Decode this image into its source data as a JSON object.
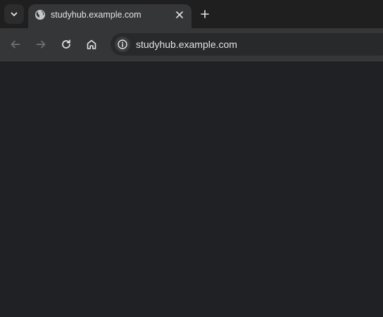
{
  "tab": {
    "title": "studyhub.example.com",
    "favicon": "globe-icon"
  },
  "toolbar": {
    "url": "studyhub.example.com",
    "icons": [
      "back-arrow-icon",
      "forward-arrow-icon",
      "reload-icon",
      "home-icon",
      "site-info-icon"
    ]
  },
  "colors": {
    "tabstrip": "#1f1f1f",
    "active_tab": "#353638",
    "toolbar": "#353638",
    "omnibox": "#28292b",
    "page": "#202124",
    "text": "#e3e3e3",
    "disabled_icon": "#6f6f6f"
  }
}
